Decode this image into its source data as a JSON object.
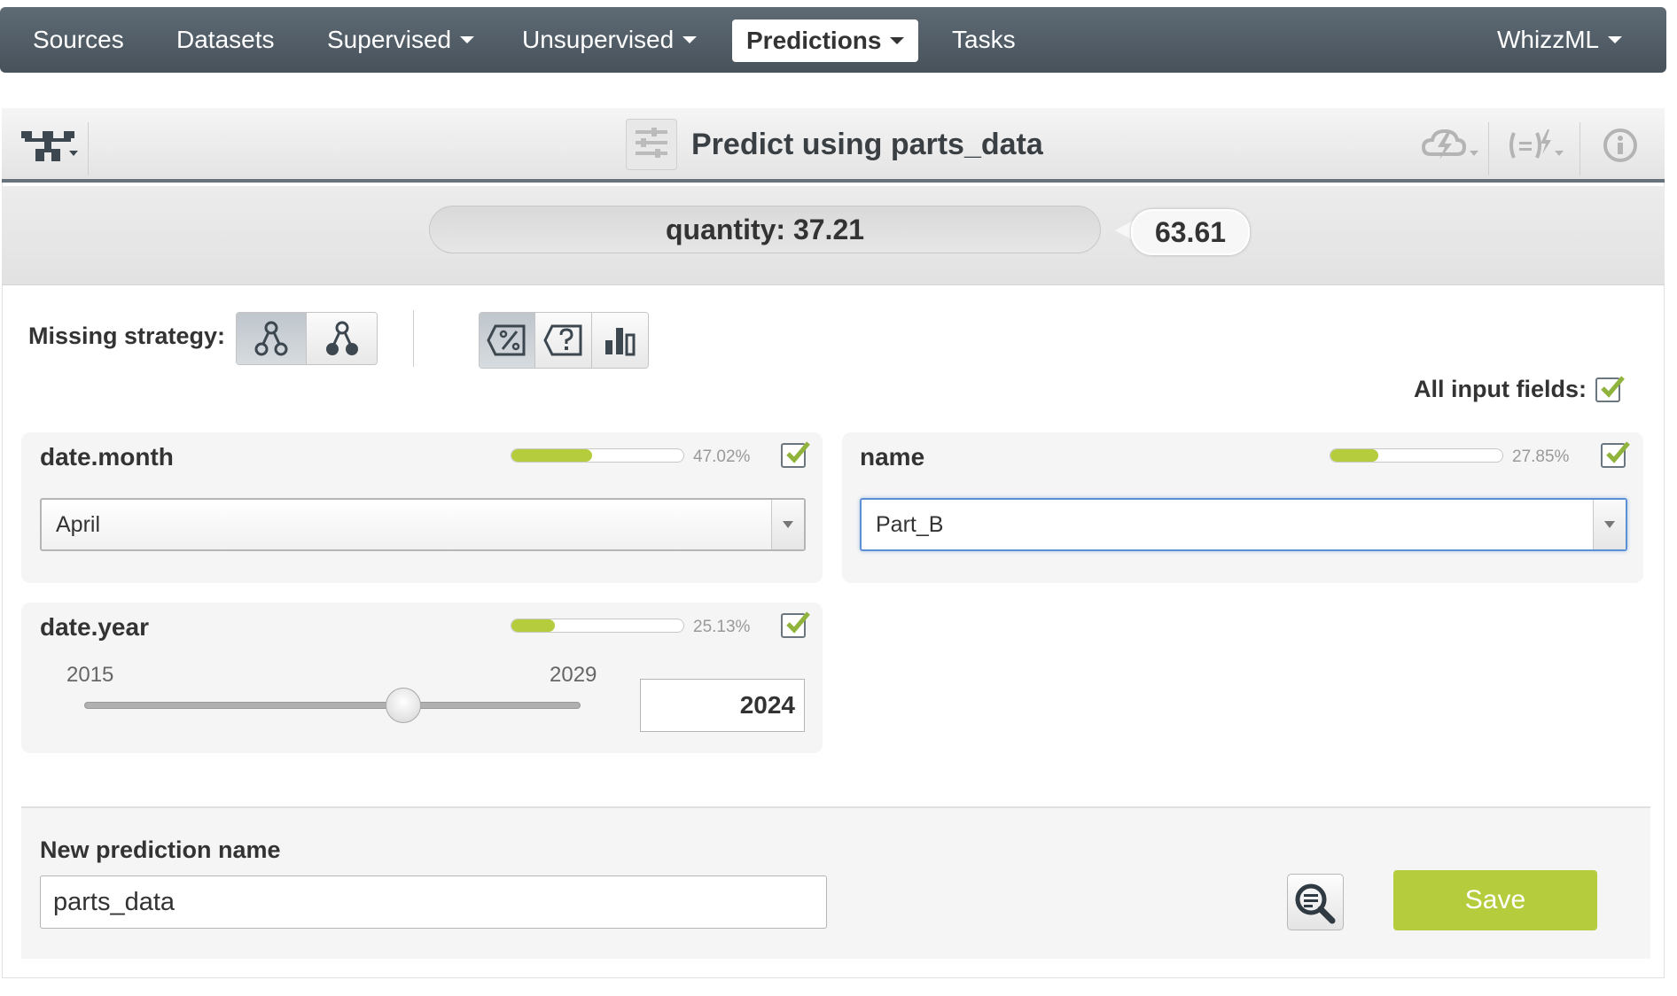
{
  "nav": {
    "items": [
      "Sources",
      "Datasets",
      "Supervised",
      "Unsupervised",
      "Predictions",
      "Tasks",
      "WhizzML"
    ],
    "active": "Predictions"
  },
  "header": {
    "title": "Predict using parts_data"
  },
  "prediction": {
    "label": "quantity: 37.21",
    "confidence": "63.61"
  },
  "controls": {
    "missing_strategy_label": "Missing strategy:",
    "all_input_fields_label": "All input fields:",
    "all_input_fields_checked": true
  },
  "fields": [
    {
      "name": "date.month",
      "importance_pct": "47.02%",
      "importance": 0.4702,
      "checked": true,
      "value": "April"
    },
    {
      "name": "name",
      "importance_pct": "27.85%",
      "importance": 0.2785,
      "checked": true,
      "value": "Part_B"
    },
    {
      "name": "date.year",
      "importance_pct": "25.13%",
      "importance": 0.2513,
      "checked": true,
      "min": "2015",
      "max": "2029",
      "value": "2024"
    }
  ],
  "footer": {
    "new_prediction_name_label": "New prediction name",
    "new_prediction_name_value": "parts_data",
    "save_label": "Save"
  },
  "colors": {
    "accent_green": "#b5cc3d",
    "nav_bg": "#525d66",
    "focus_blue": "#5b8fd6"
  }
}
